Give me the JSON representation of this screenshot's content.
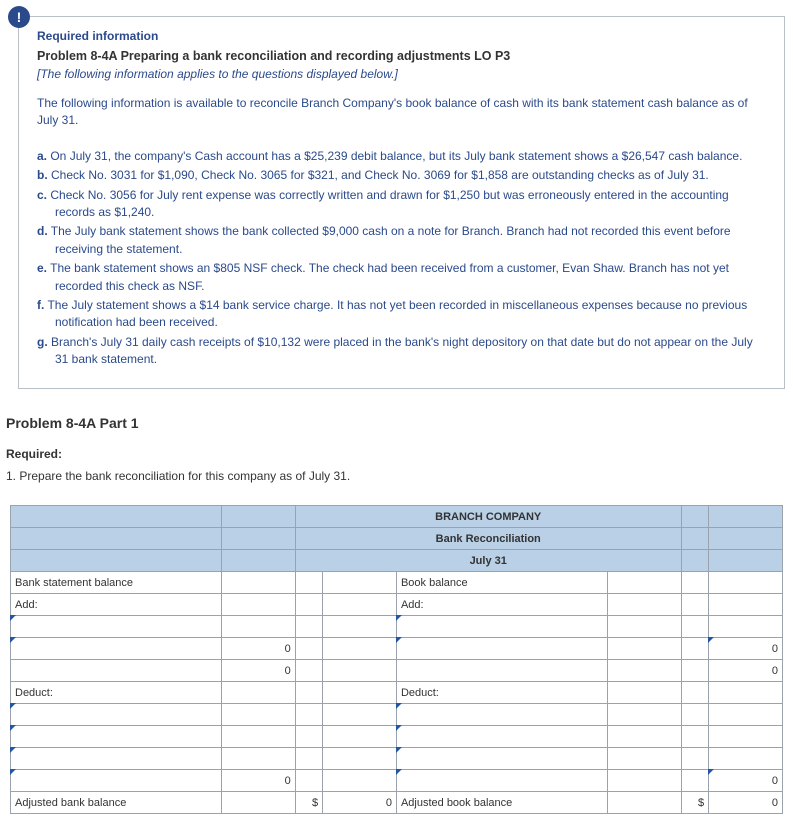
{
  "badge": "!",
  "required_info_label": "Required information",
  "problem_title": "Problem 8-4A Preparing a bank reconciliation and recording adjustments LO P3",
  "applies_note": "[The following information applies to the questions displayed below.]",
  "intro_para": "The following information is available to reconcile Branch Company's book balance of cash with its bank statement cash balance as of July 31.",
  "items": {
    "a": {
      "marker": "a.",
      "text": " On July 31, the company's Cash account has a $25,239 debit balance, but its July bank statement shows a $26,547 cash balance."
    },
    "b": {
      "marker": "b.",
      "text": " Check No. 3031 for $1,090, Check No. 3065 for $321, and Check No. 3069 for $1,858 are outstanding checks as of July 31."
    },
    "c": {
      "marker": "c.",
      "text": " Check No. 3056 for July rent expense was correctly written and drawn for $1,250 but was erroneously entered in the accounting records as $1,240."
    },
    "d": {
      "marker": "d.",
      "text": " The July bank statement shows the bank collected $9,000 cash on a note for Branch. Branch had not recorded this event before receiving the statement."
    },
    "e": {
      "marker": "e.",
      "text": " The bank statement shows an $805 NSF check. The check had been received from a customer, Evan Shaw. Branch has not yet recorded this check as NSF."
    },
    "f": {
      "marker": "f.",
      "text": " The July statement shows a $14 bank service charge. It has not yet been recorded in miscellaneous expenses because no previous notification had been received."
    },
    "g": {
      "marker": "g.",
      "text": " Branch's July 31 daily cash receipts of $10,132 were placed in the bank's night depository on that date but do not appear on the July 31 bank statement."
    }
  },
  "part_title": "Problem 8-4A Part 1",
  "required_label": "Required:",
  "task": "1. Prepare the bank reconciliation for this company as of July 31.",
  "recon": {
    "company": "BRANCH COMPANY",
    "title": "Bank Reconciliation",
    "date": "July 31",
    "left": {
      "balance_label": "Bank statement balance",
      "add_label": "Add:",
      "add_rows": [
        {
          "desc": "",
          "amt": "",
          "line": ""
        },
        {
          "desc": "",
          "amt": "0",
          "line": ""
        },
        {
          "desc": "",
          "amt": "0",
          "line": ""
        }
      ],
      "deduct_label": "Deduct:",
      "ded_rows": [
        {
          "desc": "",
          "amt": "",
          "line": ""
        },
        {
          "desc": "",
          "amt": "",
          "line": ""
        },
        {
          "desc": "",
          "amt": "",
          "line": ""
        },
        {
          "desc": "",
          "amt": "0",
          "line": ""
        }
      ],
      "adjusted_label": "Adjusted bank balance",
      "adjusted_cur": "$",
      "adjusted_amt": "0"
    },
    "right": {
      "balance_label": "Book balance",
      "add_label": "Add:",
      "add_rows": [
        {
          "desc": "",
          "amt": "",
          "line": ""
        },
        {
          "desc": "",
          "amt": "",
          "line": "0"
        },
        {
          "desc": "",
          "amt": "",
          "line": "0"
        }
      ],
      "deduct_label": "Deduct:",
      "ded_rows": [
        {
          "desc": "",
          "amt": "",
          "line": ""
        },
        {
          "desc": "",
          "amt": "",
          "line": ""
        },
        {
          "desc": "",
          "amt": "",
          "line": ""
        },
        {
          "desc": "",
          "amt": "",
          "line": "0"
        }
      ],
      "adjusted_label": "Adjusted book balance",
      "adjusted_cur": "$",
      "adjusted_amt": "0"
    }
  }
}
